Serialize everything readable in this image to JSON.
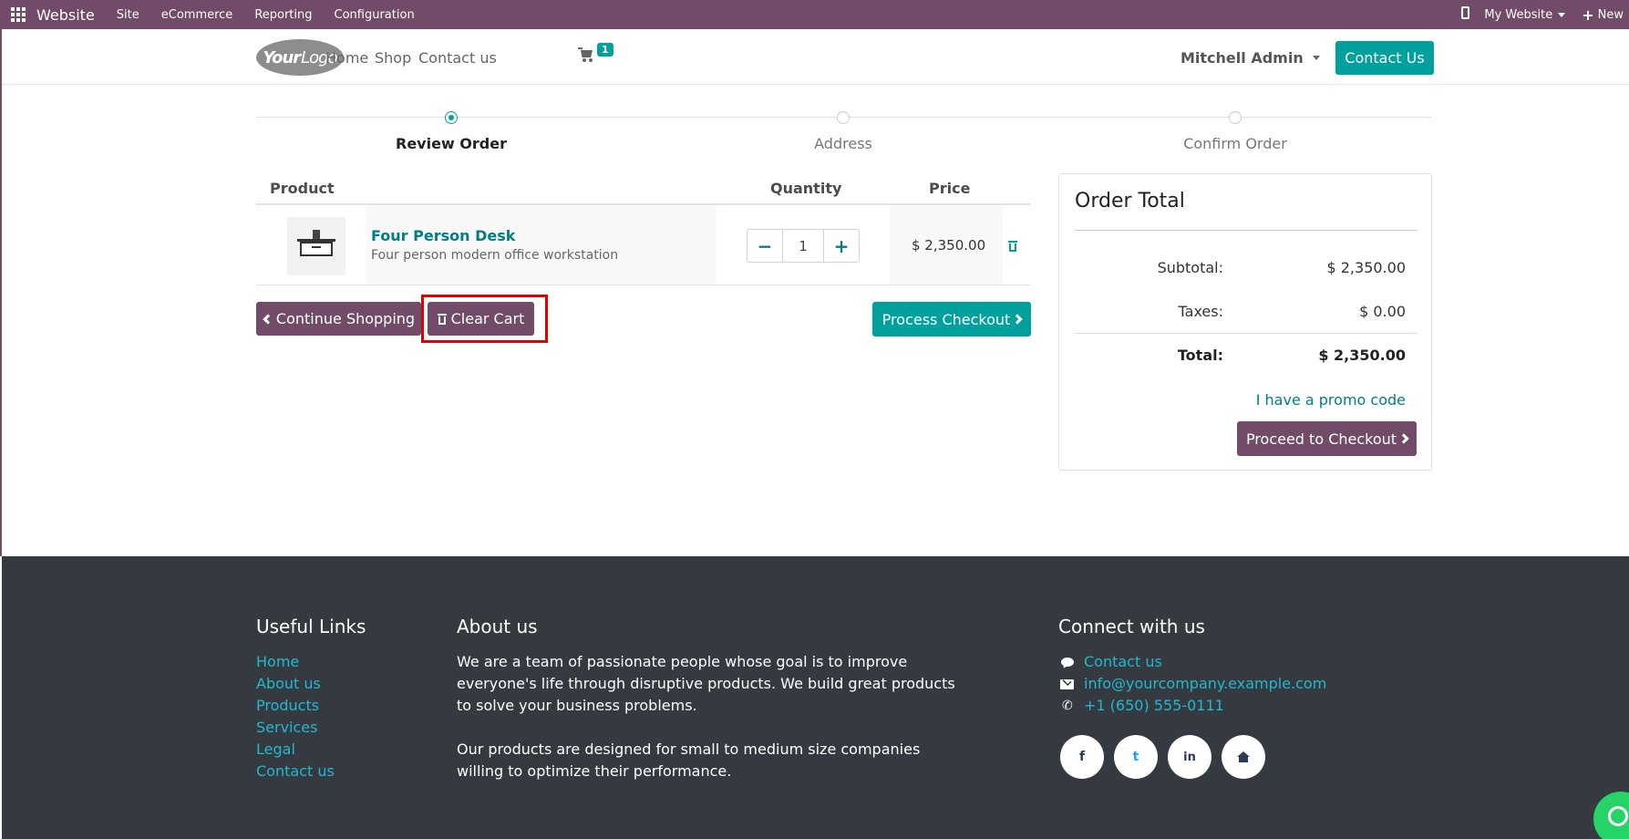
{
  "topbar": {
    "brand": "Website",
    "menu": [
      "Site",
      "eCommerce",
      "Reporting",
      "Configuration"
    ],
    "website_selector": "My Website",
    "new_label": "New"
  },
  "header": {
    "logo_your": "Your",
    "logo_logo": "Logo",
    "nav": [
      "Home",
      "Shop",
      "Contact us"
    ],
    "cart_count": "1",
    "user": "Mitchell Admin",
    "contact_button": "Contact Us"
  },
  "wizard": {
    "steps": [
      "Review Order",
      "Address",
      "Confirm Order"
    ],
    "active_step": 0
  },
  "cart": {
    "headers": {
      "product": "Product",
      "quantity": "Quantity",
      "price": "Price"
    },
    "items": [
      {
        "name": "Four Person Desk",
        "description": "Four person modern office workstation",
        "quantity": "1",
        "price": "$ 2,350.00"
      }
    ],
    "continue_shopping": "Continue Shopping",
    "clear_cart": "Clear Cart",
    "process_checkout": "Process Checkout"
  },
  "order_total": {
    "title": "Order Total",
    "subtotal_label": "Subtotal:",
    "subtotal": "$ 2,350.00",
    "taxes_label": "Taxes:",
    "taxes": "$ 0.00",
    "total_label": "Total:",
    "total": "$ 2,350.00",
    "promo": "I have a promo code",
    "proceed": "Proceed to Checkout"
  },
  "footer": {
    "useful_links_title": "Useful Links",
    "useful_links": [
      "Home",
      "About us",
      "Products",
      "Services",
      "Legal",
      "Contact us"
    ],
    "about_title": "About us",
    "about_lines_1": [
      "We are a team of passionate people whose goal is to improve",
      "everyone's life through disruptive products. We build great products",
      "to solve your business problems."
    ],
    "about_lines_2": [
      "Our products are designed for small to medium size companies",
      "willing to optimize their performance."
    ],
    "connect_title": "Connect with us",
    "contact_us": "Contact us",
    "email": "info@yourcompany.example.com",
    "phone": "+1 (650) 555-0111",
    "social": [
      "f",
      "t",
      "in"
    ]
  },
  "colors": {
    "odoo_purple": "#714b67",
    "teal": "#00a09d",
    "footer_bg": "#343a40",
    "link_teal": "#017e84",
    "footer_link": "#22b8cf",
    "highlight": "#e00000"
  }
}
